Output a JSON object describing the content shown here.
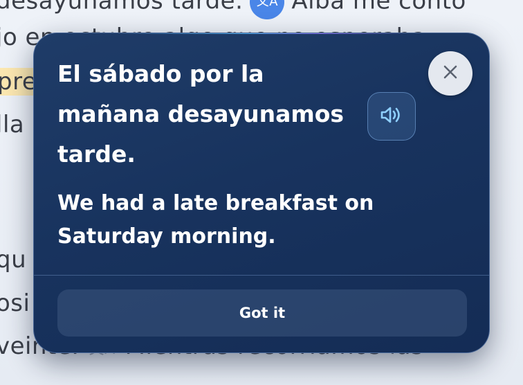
{
  "background": {
    "lines": [
      {
        "before": "desayunamos tarde.",
        "chip": "文A",
        "after": "Alba me contó"
      },
      {
        "before": "jo en octubre algo que no esperaba"
      },
      {
        "highlight": "pres"
      },
      {
        "before": "lla"
      },
      {
        "before": ""
      },
      {
        "before": "qu"
      },
      {
        "before": "osi"
      },
      {
        "before": "veinte.",
        "mark": "文A",
        "after": "Mientras recorríamos las"
      },
      {
        "before": ""
      }
    ]
  },
  "popover": {
    "source_text": "El sábado por la mañana desayunamos tarde.",
    "translation_text": "We had a late breakfast on Saturday morning.",
    "got_it_label": "Got it"
  },
  "icons": {
    "speak": "speaker-icon",
    "close": "close-icon"
  },
  "colors": {
    "popover_bg": "#18335e",
    "accent_chip": "#4a86e8",
    "highlight": "#fbe7b0",
    "underline": "#f3a63c"
  }
}
